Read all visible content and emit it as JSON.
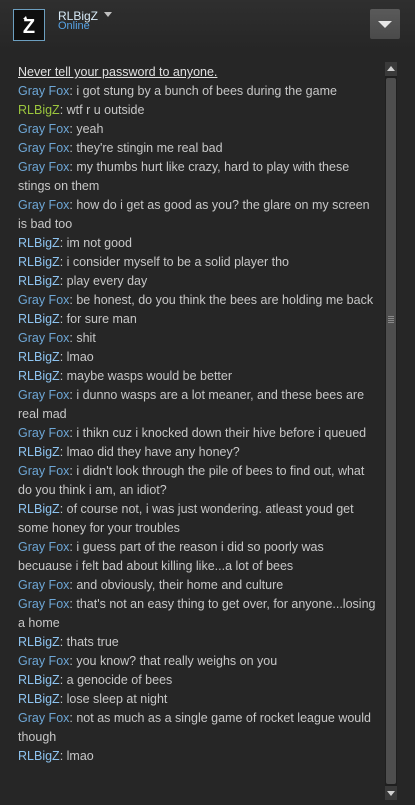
{
  "header": {
    "username": "RLBigZ",
    "status": "Online",
    "avatar_letter": "Z",
    "menu_icon": "chevron-down-icon"
  },
  "chat": {
    "warning": "Never tell your password to anyone.",
    "messages": [
      {
        "sender": "Gray Fox",
        "text": "i got stung by a bunch of bees during the game"
      },
      {
        "sender": "RLBigZ",
        "text": "wtf r u outside"
      },
      {
        "sender": "Gray Fox",
        "text": "yeah"
      },
      {
        "sender": "Gray Fox",
        "text": "they're stingin me real bad"
      },
      {
        "sender": "Gray Fox",
        "text": "my thumbs hurt like crazy, hard to play with these stings on them"
      },
      {
        "sender": "Gray Fox",
        "text": "how do i get as good as you? the glare on my screen is bad too"
      },
      {
        "sender": "RLBigZ",
        "text": "im not good"
      },
      {
        "sender": "RLBigZ",
        "text": "i consider myself to be a solid player tho"
      },
      {
        "sender": "RLBigZ",
        "text": "play every day"
      },
      {
        "sender": "Gray Fox",
        "text": "be honest, do you think the bees are holding me back"
      },
      {
        "sender": "RLBigZ",
        "text": "for sure man"
      },
      {
        "sender": "Gray Fox",
        "text": "shit"
      },
      {
        "sender": "RLBigZ",
        "text": "lmao"
      },
      {
        "sender": "RLBigZ",
        "text": "maybe wasps would be better"
      },
      {
        "sender": "Gray Fox",
        "text": "i dunno wasps are a lot meaner, and these bees are real mad"
      },
      {
        "sender": "Gray Fox",
        "text": "i thikn cuz i knocked down their hive before i queued"
      },
      {
        "sender": "RLBigZ",
        "text": "lmao did they have any honey?"
      },
      {
        "sender": "Gray Fox",
        "text": "i didn't look through the pile of bees to find out, what do you think i am, an idiot?"
      },
      {
        "sender": "RLBigZ",
        "text": "of course not, i was just wondering.  atleast youd get some honey for your troubles"
      },
      {
        "sender": "Gray Fox",
        "text": "i guess part of the reason i did so poorly was becuause i felt bad about killing like...a lot of bees"
      },
      {
        "sender": "Gray Fox",
        "text": "and obviously, their home and culture"
      },
      {
        "sender": "Gray Fox",
        "text": "that's not an easy thing to get over, for anyone...losing a home"
      },
      {
        "sender": "RLBigZ",
        "text": "thats true"
      },
      {
        "sender": "Gray Fox",
        "text": "you know? that really weighs on you"
      },
      {
        "sender": "RLBigZ",
        "text": "a genocide of bees"
      },
      {
        "sender": "RLBigZ",
        "text": "lose sleep at night"
      },
      {
        "sender": "Gray Fox",
        "text": "not as much as a single game of rocket league would though"
      },
      {
        "sender": "RLBigZ",
        "text": "lmao"
      }
    ]
  }
}
